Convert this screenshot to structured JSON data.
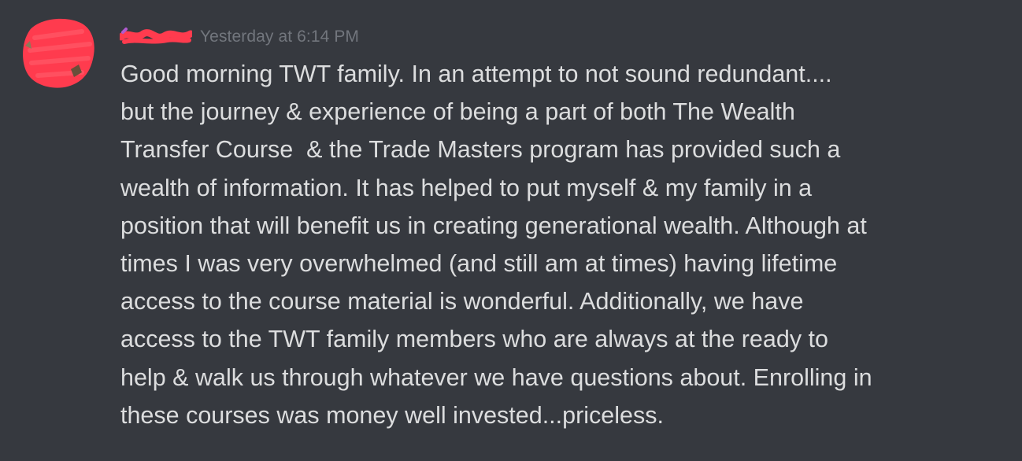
{
  "message": {
    "timestamp": "Yesterday at 6:14 PM",
    "lines": [
      "Good morning TWT family. In an attempt to not sound redundant....",
      "but the journey & experience of being a part of both The Wealth",
      "Transfer Course  & the Trade Masters program has provided such a",
      "wealth of information. It has helped to put myself & my family in a",
      "position that will benefit us in creating generational wealth. Although at",
      "times I was very overwhelmed (and still am at times) having lifetime",
      "access to the course material is wonderful. Additionally, we have",
      "access to the TWT family members who are always at the ready to",
      "help & walk us through whatever we have questions about. Enrolling in",
      "these courses was money well invested...priceless."
    ]
  },
  "colors": {
    "background": "#36393f",
    "text": "#dcddde",
    "timestamp": "#72767d",
    "redaction": "#ff3b4e"
  }
}
